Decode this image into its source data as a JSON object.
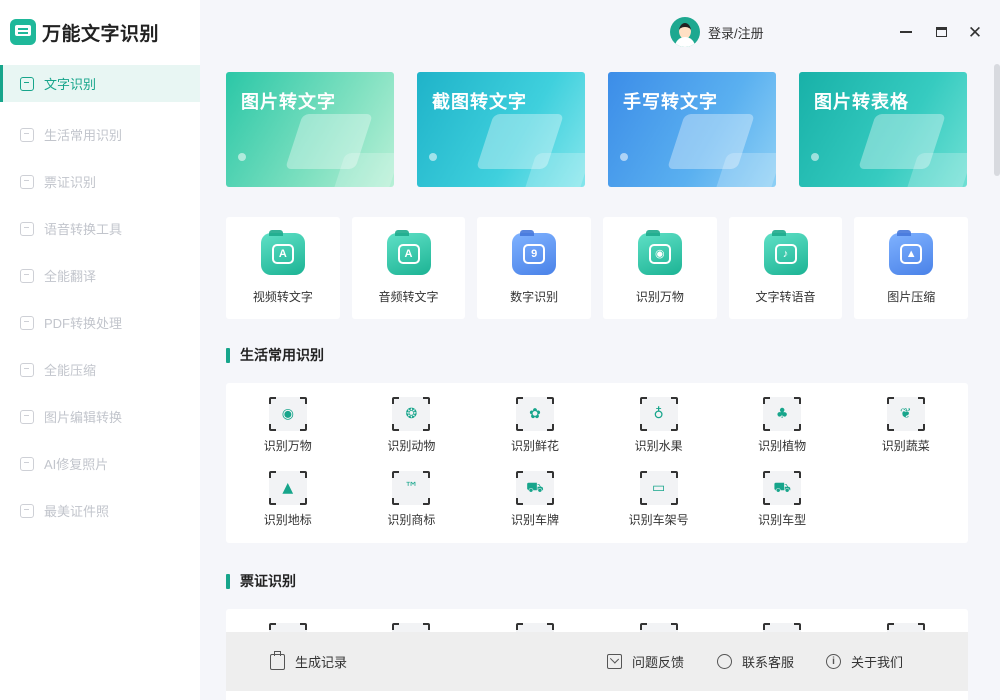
{
  "app": {
    "title": "万能文字识别"
  },
  "sidebar": {
    "items": [
      {
        "label": "文字识别",
        "active": true
      },
      {
        "label": "生活常用识别"
      },
      {
        "label": "票证识别"
      },
      {
        "label": "语音转换工具"
      },
      {
        "label": "全能翻译"
      },
      {
        "label": "PDF转换处理"
      },
      {
        "label": "全能压缩"
      },
      {
        "label": "图片编辑转换"
      },
      {
        "label": "AI修复照片"
      },
      {
        "label": "最美证件照"
      }
    ]
  },
  "header": {
    "login_label": "登录/注册"
  },
  "banners": [
    {
      "title": "图片转文字"
    },
    {
      "title": "截图转文字"
    },
    {
      "title": "手写转文字"
    },
    {
      "title": "图片转表格"
    }
  ],
  "tools": [
    {
      "label": "视频转文字",
      "glyph": "A",
      "color": "teal"
    },
    {
      "label": "音频转文字",
      "glyph": "A",
      "color": "teal"
    },
    {
      "label": "数字识别",
      "glyph": "9",
      "color": "blue"
    },
    {
      "label": "识别万物",
      "glyph": "◉",
      "color": "teal"
    },
    {
      "label": "文字转语音",
      "glyph": "♪",
      "color": "teal"
    },
    {
      "label": "图片压缩",
      "glyph": "▲",
      "color": "blue"
    }
  ],
  "life_section": {
    "title": "生活常用识别",
    "items": [
      {
        "label": "识别万物",
        "icon": "eye-icon",
        "glyph": "◉"
      },
      {
        "label": "识别动物",
        "icon": "animal-icon",
        "glyph": "❂"
      },
      {
        "label": "识别鲜花",
        "icon": "flower-icon",
        "glyph": "✿"
      },
      {
        "label": "识别水果",
        "icon": "fruit-icon",
        "glyph": "♁"
      },
      {
        "label": "识别植物",
        "icon": "plant-icon",
        "glyph": "♣"
      },
      {
        "label": "识别蔬菜",
        "icon": "vegetable-icon",
        "glyph": "❦"
      },
      {
        "label": "识别地标",
        "icon": "landmark-icon",
        "glyph": "▲"
      },
      {
        "label": "识别商标",
        "icon": "trademark-icon",
        "glyph": "™"
      },
      {
        "label": "识别车牌",
        "icon": "car-icon",
        "glyph": "⛟"
      },
      {
        "label": "识别车架号",
        "icon": "vin-icon",
        "glyph": "▭"
      },
      {
        "label": "识别车型",
        "icon": "truck-icon",
        "glyph": "⛟"
      }
    ]
  },
  "ticket_section": {
    "title": "票证识别",
    "count": 6
  },
  "footer": {
    "history_label": "生成记录",
    "feedback_label": "问题反馈",
    "support_label": "联系客服",
    "about_label": "关于我们"
  }
}
